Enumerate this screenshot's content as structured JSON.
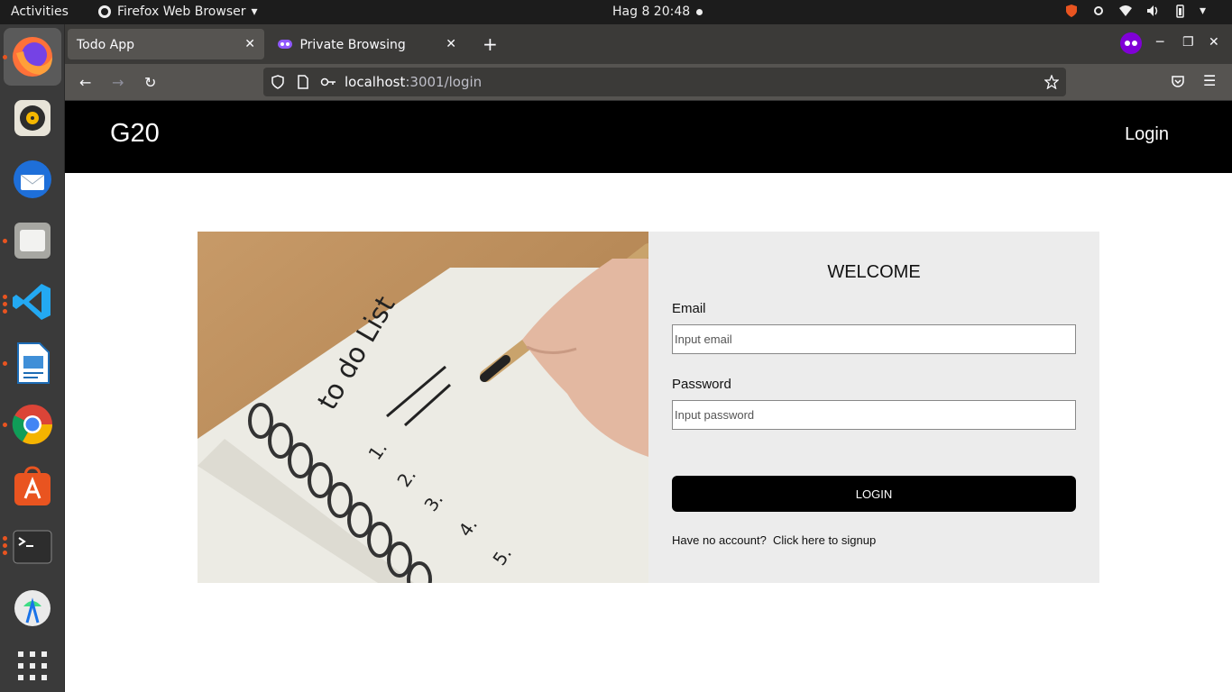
{
  "system": {
    "activities": "Activities",
    "app_menu": "Firefox Web Browser",
    "clock": "Hag 8  20:48"
  },
  "browser": {
    "tabs": [
      {
        "label": "Todo App"
      },
      {
        "label": "Private Browsing"
      }
    ],
    "url_host": "localhost",
    "url_rest": ":3001/login"
  },
  "site": {
    "brand": "G20",
    "nav_login": "Login"
  },
  "form": {
    "title": "WELCOME",
    "email_label": "Email",
    "email_placeholder": "Input email",
    "password_label": "Password",
    "password_placeholder": "Input password",
    "login_button": "LOGIN",
    "signup_prompt": "Have no account?",
    "signup_link": "Click here to signup"
  },
  "hero_image": {
    "heading_text": "to do List",
    "list_numbers": [
      "1.",
      "2.",
      "3.",
      "4.",
      "5."
    ]
  },
  "colors": {
    "header_bg": "#000000",
    "card_bg": "#ececec",
    "button_bg": "#000000",
    "ubuntu_accent": "#e95420"
  }
}
